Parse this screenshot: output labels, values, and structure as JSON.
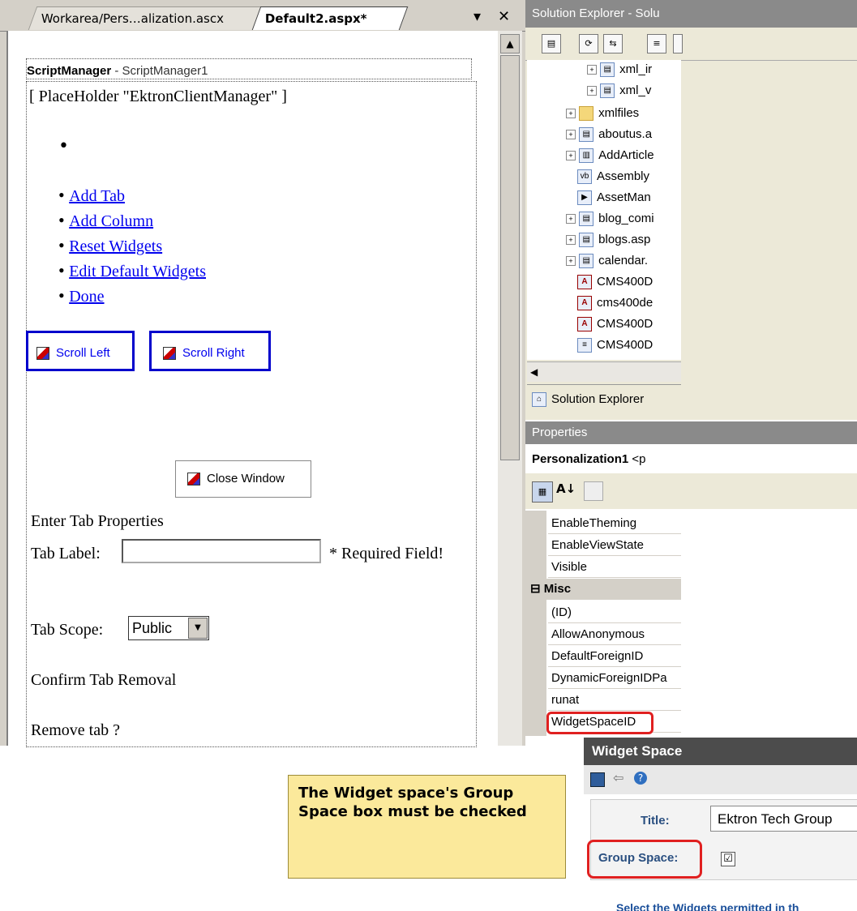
{
  "designer": {
    "tabs": [
      "Workarea/Pers…alization.ascx",
      "Default2.aspx*"
    ],
    "tab_controls": {
      "menu": "▾",
      "close": "✕"
    },
    "script_manager_label": "ScriptManager",
    "script_manager_id": "- ScriptManager1",
    "placeholder_label": "[ PlaceHolder \"EktronClientManager\" ]",
    "links": [
      "Add Tab",
      "Add Column",
      "Reset Widgets",
      "Edit Default Widgets",
      "Done"
    ],
    "scroll_left": "Scroll Left",
    "scroll_right": "Scroll Right",
    "close_window": "Close Window",
    "enter_tab_properties": "Enter Tab Properties",
    "tab_label": "Tab Label:",
    "required": "* Required Field!",
    "tab_scope": "Tab Scope:",
    "scope_value": "Public",
    "confirm_removal": "Confirm Tab Removal",
    "remove_tab": "Remove tab ?"
  },
  "solution_explorer": {
    "title": "Solution Explorer - Solu",
    "items": [
      "xml_ir",
      "xml_v",
      "xmlfiles",
      "aboutus.a",
      "AddArticle",
      "Assembly",
      "AssetMan",
      "blog_comi",
      "blogs.asp",
      "calendar.",
      "CMS400D",
      "cms400de",
      "CMS400D",
      "CMS400D"
    ],
    "tab_label": "Solution Explorer"
  },
  "properties": {
    "title": "Properties",
    "object": "Personalization1",
    "object_suffix": "<p",
    "rows_top": [
      "EnableTheming",
      "EnableViewState",
      "Visible"
    ],
    "misc": "Misc",
    "rows_misc": [
      "(ID)",
      "AllowAnonymous",
      "DefaultForeignID",
      "DynamicForeignIDPa",
      "runat",
      "WidgetSpaceID"
    ]
  },
  "widget_space": {
    "header": "Widget Space",
    "title_label": "Title:",
    "title_value": "Ektron Tech Group",
    "group_space_label": "Group Space:",
    "group_space_checked": "☑",
    "cutoff_text": "Select the Widgets permitted in th"
  },
  "note": "The Widget space's Group Space box must be checked"
}
